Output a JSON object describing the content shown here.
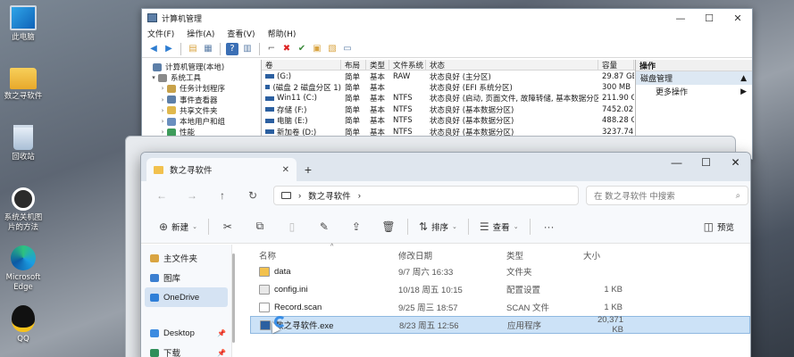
{
  "desktop": {
    "icons": [
      {
        "label": "此电脑",
        "icon": "this-pc-icon"
      },
      {
        "label": "数之寻软件",
        "icon": "folder-icon"
      },
      {
        "label": "回收站",
        "icon": "recycle-bin-icon"
      },
      {
        "label": "系统关机图\n片的方法",
        "icon": "shortcut-icon"
      },
      {
        "label": "Microsoft\nEdge",
        "icon": "edge-icon"
      },
      {
        "label": "QQ",
        "icon": "qq-icon"
      }
    ]
  },
  "mgmt": {
    "title": "计算机管理",
    "menu": [
      "文件(F)",
      "操作(A)",
      "查看(V)",
      "帮助(H)"
    ],
    "tree": [
      {
        "label": "计算机管理(本地)",
        "exp": "",
        "color": "#5d7fa8"
      },
      {
        "label": "系统工具",
        "exp": "▾",
        "color": "#8a8a8a"
      },
      {
        "label": "任务计划程序",
        "exp": "›",
        "color": "#c8a24a"
      },
      {
        "label": "事件查看器",
        "exp": "›",
        "color": "#5d7fa8"
      },
      {
        "label": "共享文件夹",
        "exp": "›",
        "color": "#e0b84d"
      },
      {
        "label": "本地用户和组",
        "exp": "›",
        "color": "#6a8fbf"
      },
      {
        "label": "性能",
        "exp": "›",
        "color": "#3d9b5a"
      }
    ],
    "columns": {
      "vol": "卷",
      "layout": "布局",
      "type": "类型",
      "fs": "文件系统",
      "status": "状态",
      "cap": "容量"
    },
    "volumes": [
      {
        "vol": "(G:)",
        "layout": "简单",
        "type": "基本",
        "fs": "RAW",
        "status": "状态良好 (主分区)",
        "cap": "29.87 GB"
      },
      {
        "vol": "(磁盘 2 磁盘分区 1)",
        "layout": "简单",
        "type": "基本",
        "fs": "",
        "status": "状态良好 (EFI 系统分区)",
        "cap": "300 MB"
      },
      {
        "vol": "Win11 (C:)",
        "layout": "简单",
        "type": "基本",
        "fs": "NTFS",
        "status": "状态良好 (启动, 页面文件, 故障转储, 基本数据分区)",
        "cap": "211.90 GB"
      },
      {
        "vol": "存储 (F:)",
        "layout": "简单",
        "type": "基本",
        "fs": "NTFS",
        "status": "状态良好 (基本数据分区)",
        "cap": "7452.02 GB"
      },
      {
        "vol": "电脑 (E:)",
        "layout": "简单",
        "type": "基本",
        "fs": "NTFS",
        "status": "状态良好 (基本数据分区)",
        "cap": "488.28 GB"
      },
      {
        "vol": "新加卷 (D:)",
        "layout": "简单",
        "type": "基本",
        "fs": "NTFS",
        "status": "状态良好 (基本数据分区)",
        "cap": "3237.74 GB"
      }
    ],
    "actions": {
      "header": "操作",
      "item": "磁盘管理",
      "sub": "更多操作"
    }
  },
  "explorer": {
    "tab_title": "数之寻软件",
    "address": "数之寻软件",
    "search_placeholder": "在 数之寻软件 中搜索",
    "commands": {
      "new": "新建",
      "sort": "排序",
      "view": "查看",
      "preview": "预览"
    },
    "sidebar": [
      {
        "label": "主文件夹",
        "color": "#d9a441",
        "sel": false,
        "pin": false
      },
      {
        "label": "图库",
        "color": "#3b7fd1",
        "sel": false,
        "pin": false
      },
      {
        "label": "OneDrive",
        "color": "#2f7fd8",
        "sel": true,
        "pin": false
      },
      {
        "label": "Desktop",
        "color": "#3c8be0",
        "sel": false,
        "pin": true
      },
      {
        "label": "下载",
        "color": "#2f8f5a",
        "sel": false,
        "pin": true
      }
    ],
    "columns": {
      "name": "名称",
      "date": "修改日期",
      "type": "类型",
      "size": "大小"
    },
    "files": [
      {
        "name": "data",
        "date": "9/7 周六 16:33",
        "type": "文件夹",
        "size": "",
        "icon": "folder-icon",
        "color": "#f2c14e",
        "sel": false
      },
      {
        "name": "config.ini",
        "date": "10/18 周五 10:15",
        "type": "配置设置",
        "size": "1 KB",
        "icon": "ini-file-icon",
        "color": "#e8e8e8",
        "sel": false
      },
      {
        "name": "Record.scan",
        "date": "9/25 周三 18:57",
        "type": "SCAN 文件",
        "size": "1 KB",
        "icon": "scan-file-icon",
        "color": "#ffffff",
        "sel": false
      },
      {
        "name": "数之寻软件.exe",
        "date": "8/23 周五 12:56",
        "type": "应用程序",
        "size": "20,371 KB",
        "icon": "exe-file-icon",
        "color": "#2b5fa0",
        "sel": true
      }
    ]
  }
}
